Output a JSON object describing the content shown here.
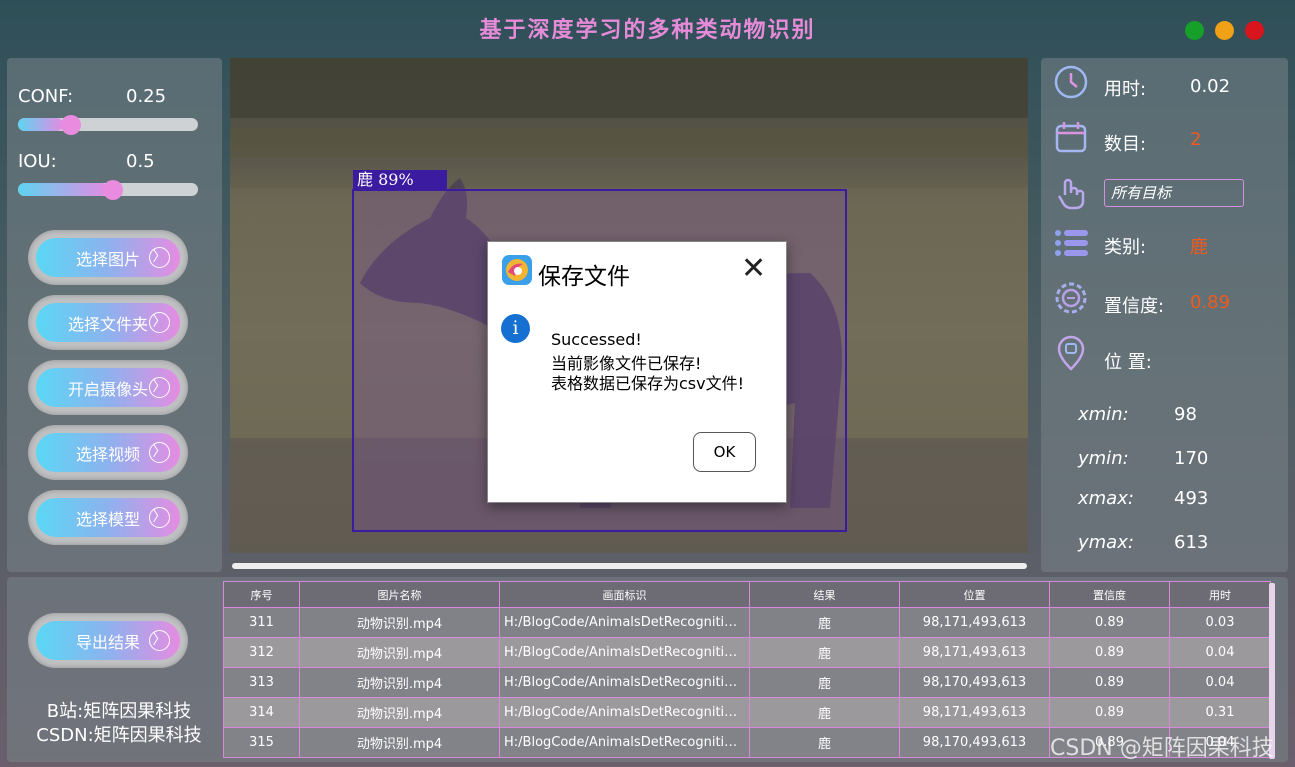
{
  "app": {
    "title": "基于深度学习的多种类动物识别"
  },
  "window_controls": {
    "colors": [
      "#16a02a",
      "#f0a116",
      "#d8141c"
    ]
  },
  "sliders": {
    "conf": {
      "label": "CONF:",
      "value": "0.25",
      "level": 0.25
    },
    "iou": {
      "label": "IOU:",
      "value": "0.5",
      "level": 0.5
    }
  },
  "nav_buttons": [
    {
      "label": "选择图片",
      "arrow": "〉"
    },
    {
      "label": "选择文件夹",
      "arrow": "〉"
    },
    {
      "label": "开启摄像头",
      "arrow": "〉"
    },
    {
      "label": "选择视频",
      "arrow": "〉"
    },
    {
      "label": "选择模型",
      "arrow": "〉"
    }
  ],
  "export_button": {
    "label": "导出结果",
    "arrow": "〉"
  },
  "detection": {
    "label_text": "鹿 89%",
    "box_color": "#3b1ba0"
  },
  "info": {
    "time_label": "用时:",
    "time_value": "0.02",
    "count_label": "数目:",
    "count_value": "2",
    "target_select": "所有目标",
    "class_label": "类别:",
    "class_value": "鹿",
    "conf_label": "置信度:",
    "conf_value": "0.89",
    "pos_label": "位 置:",
    "xmin_label": "xmin:",
    "xmin_value": "98",
    "ymin_label": "ymin:",
    "ymin_value": "170",
    "xmax_label": "xmax:",
    "xmax_value": "493",
    "ymax_label": "ymax:",
    "ymax_value": "613",
    "accent_color": "#f05a1e"
  },
  "table": {
    "headers": [
      "序号",
      "图片名称",
      "画面标识",
      "结果",
      "位置",
      "置信度",
      "用时"
    ],
    "rows": [
      [
        "311",
        "动物识别.mp4",
        "H:/BlogCode/AnimalsDetRecognition...",
        "鹿",
        "98,171,493,613",
        "0.89",
        "0.03"
      ],
      [
        "312",
        "动物识别.mp4",
        "H:/BlogCode/AnimalsDetRecognition...",
        "鹿",
        "98,171,493,613",
        "0.89",
        "0.04"
      ],
      [
        "313",
        "动物识别.mp4",
        "H:/BlogCode/AnimalsDetRecognition...",
        "鹿",
        "98,170,493,613",
        "0.89",
        "0.04"
      ],
      [
        "314",
        "动物识别.mp4",
        "H:/BlogCode/AnimalsDetRecognition...",
        "鹿",
        "98,171,493,613",
        "0.89",
        "0.31"
      ],
      [
        "315",
        "动物识别.mp4",
        "H:/BlogCode/AnimalsDetRecognition...",
        "鹿",
        "98,170,493,613",
        "0.89",
        "0.04"
      ]
    ]
  },
  "dialog": {
    "title": "保存文件",
    "close": "✕",
    "info_icon": "i",
    "line1": "Successed!",
    "line2": "当前影像文件已保存!",
    "line3": "表格数据已保存为csv文件!",
    "ok_label": "OK"
  },
  "credit": {
    "line1": "B站:矩阵因果科技",
    "line2": "CSDN:矩阵因果科技"
  },
  "watermark": "CSDN @矩阵因果科技"
}
